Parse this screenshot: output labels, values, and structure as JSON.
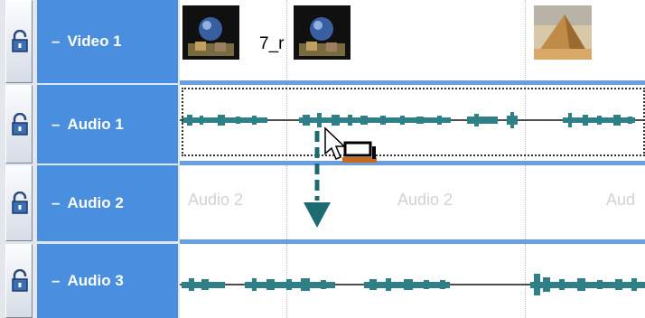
{
  "tracks": [
    {
      "id": "video-1",
      "label": "Video 1",
      "prefix": "–",
      "type": "video",
      "clip_name": "7_r"
    },
    {
      "id": "audio-1",
      "label": "Audio 1",
      "prefix": "–",
      "type": "audio",
      "selected": true
    },
    {
      "id": "audio-2",
      "label": "Audio 2",
      "prefix": "–",
      "type": "audio",
      "placeholders": [
        "Audio 2",
        "Audio 2",
        "Aud"
      ]
    },
    {
      "id": "audio-3",
      "label": "Audio 3",
      "prefix": "–",
      "type": "audio"
    }
  ],
  "icons": {
    "lock": "lock-icon",
    "cursor": "arrow-cursor-icon",
    "drag": "drag-move-icon",
    "arrow": "down-arrow-icon"
  },
  "colors": {
    "track_label": "#4a8ee0",
    "waveform": "#2f7f86",
    "separator": "#6a9ee2",
    "arrow": "#1e6a72"
  }
}
